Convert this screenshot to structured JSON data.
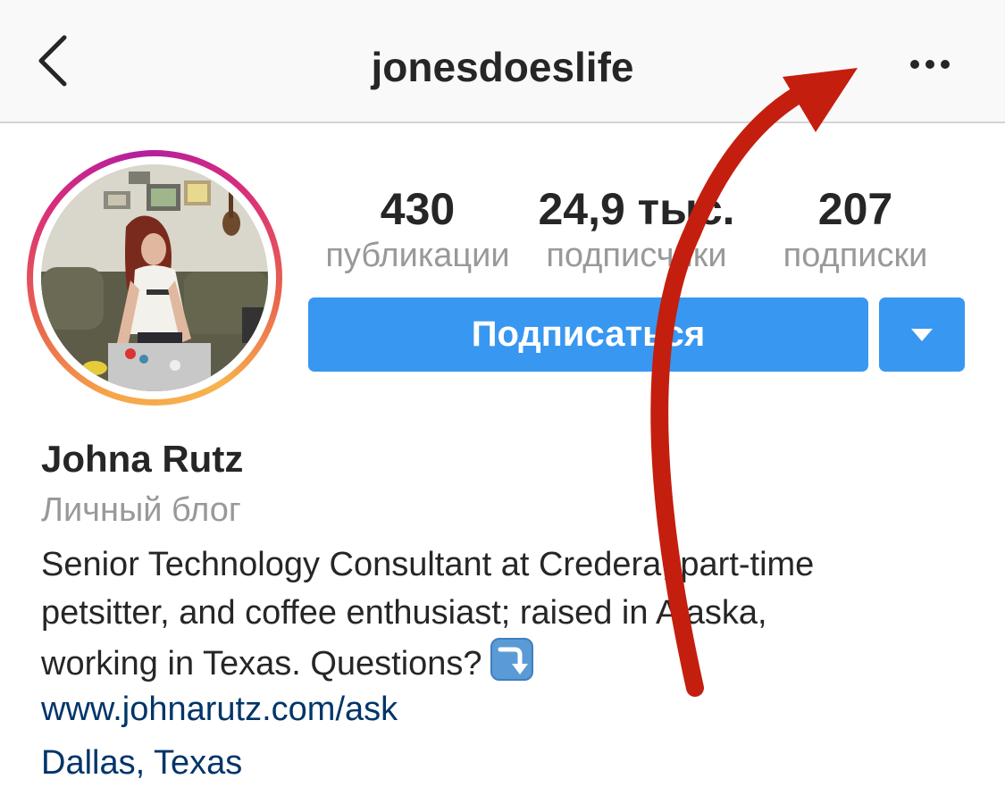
{
  "header": {
    "username": "jonesdoeslife"
  },
  "profile": {
    "stats": [
      {
        "value": "430",
        "label": "публикации"
      },
      {
        "value": "24,9 тыс.",
        "label": "подписчики"
      },
      {
        "value": "207",
        "label": "подписки"
      }
    ],
    "follow_label": "Подписаться",
    "full_name": "Johna Rutz",
    "category": "Личный блог",
    "bio_lines": [
      "Senior Technology Consultant at Credera, part-time",
      "petsitter, and coffee enthusiast; raised in Alaska,",
      "working in Texas. Questions?"
    ],
    "website": "www.johnarutz.com/ask",
    "location": "Dallas, Texas"
  },
  "icons": {
    "back": "chevron-left-icon",
    "more": "more-dots-icon",
    "dropdown": "triangle-down-icon",
    "bio_emoji": "arrow-down-right-emoji-icon"
  },
  "colors": {
    "accent_blue": "#3897f0",
    "link_blue": "#003569",
    "annotation_red": "#c41e0f",
    "muted_text": "#999999"
  }
}
